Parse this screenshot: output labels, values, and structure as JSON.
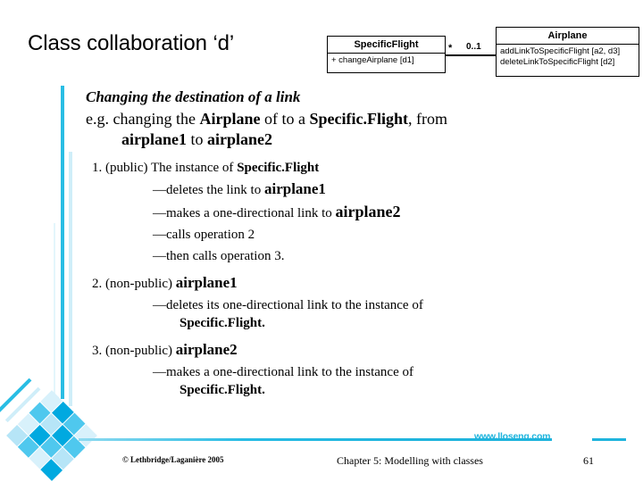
{
  "slide": {
    "title": "Class collaboration ‘d’"
  },
  "uml": {
    "left_class": {
      "name": "SpecificFlight",
      "operations": [
        "+ changeAirplane [d1]"
      ]
    },
    "right_class": {
      "name": "Airplane",
      "operations": [
        "addLinkToSpecificFlight [a2, d3]",
        "deleteLinkToSpecificFlight [d2]"
      ]
    },
    "multiplicity_left": "*",
    "multiplicity_right": "0..1"
  },
  "body": {
    "heading": "Changing the destination of a link",
    "lead_line1_a": "e.g. changing the ",
    "lead_line1_b": "Airplane",
    "lead_line1_c": " of to a ",
    "lead_line1_d": "Specific.Flight",
    "lead_line1_e": ", from",
    "lead_line2_a": "airplane1",
    "lead_line2_b": " to ",
    "lead_line2_c": "airplane2",
    "items": [
      {
        "number": "1. (public) ",
        "subject_plain": "The instance of ",
        "subject_bold": "Specific.Flight",
        "dashes": [
          {
            "text_a": "—deletes the link to ",
            "text_b": "airplane1",
            "bold_big": true
          },
          {
            "text_a": "—makes a one-directional link to ",
            "text_b": "airplane2",
            "bold_big": true
          },
          {
            "text_a": "—calls operation 2",
            "text_b": "",
            "bold_big": false
          },
          {
            "text_a": "—then calls operation 3.",
            "text_b": "",
            "bold_big": false
          }
        ]
      },
      {
        "number": "2. (non-public) ",
        "subject_plain": "",
        "subject_bold": "airplane1",
        "justified_dash": {
          "line1": "—deletes its one-directional link to the instance of",
          "line2": "Specific.Flight."
        }
      },
      {
        "number": "3. (non-public) ",
        "subject_plain": "",
        "subject_bold": "airplane2",
        "justified_dash": {
          "line1": "—makes a one-directional link to the instance of",
          "line2": "Specific.Flight."
        }
      }
    ]
  },
  "footer": {
    "url": "www.lloseng.com",
    "copyright": "© Lethbridge/Laganière 2005",
    "chapter": "Chapter 5: Modelling with classes",
    "page": "61"
  },
  "colors": {
    "accent_cyan": "#1fb4dd",
    "rail_cyan": "#29bde4",
    "rail_pale": "#cfeef9",
    "mosaic_dark": "#00a9e0",
    "mosaic_mid": "#4fc8ee",
    "mosaic_light": "#b6e5f7"
  }
}
